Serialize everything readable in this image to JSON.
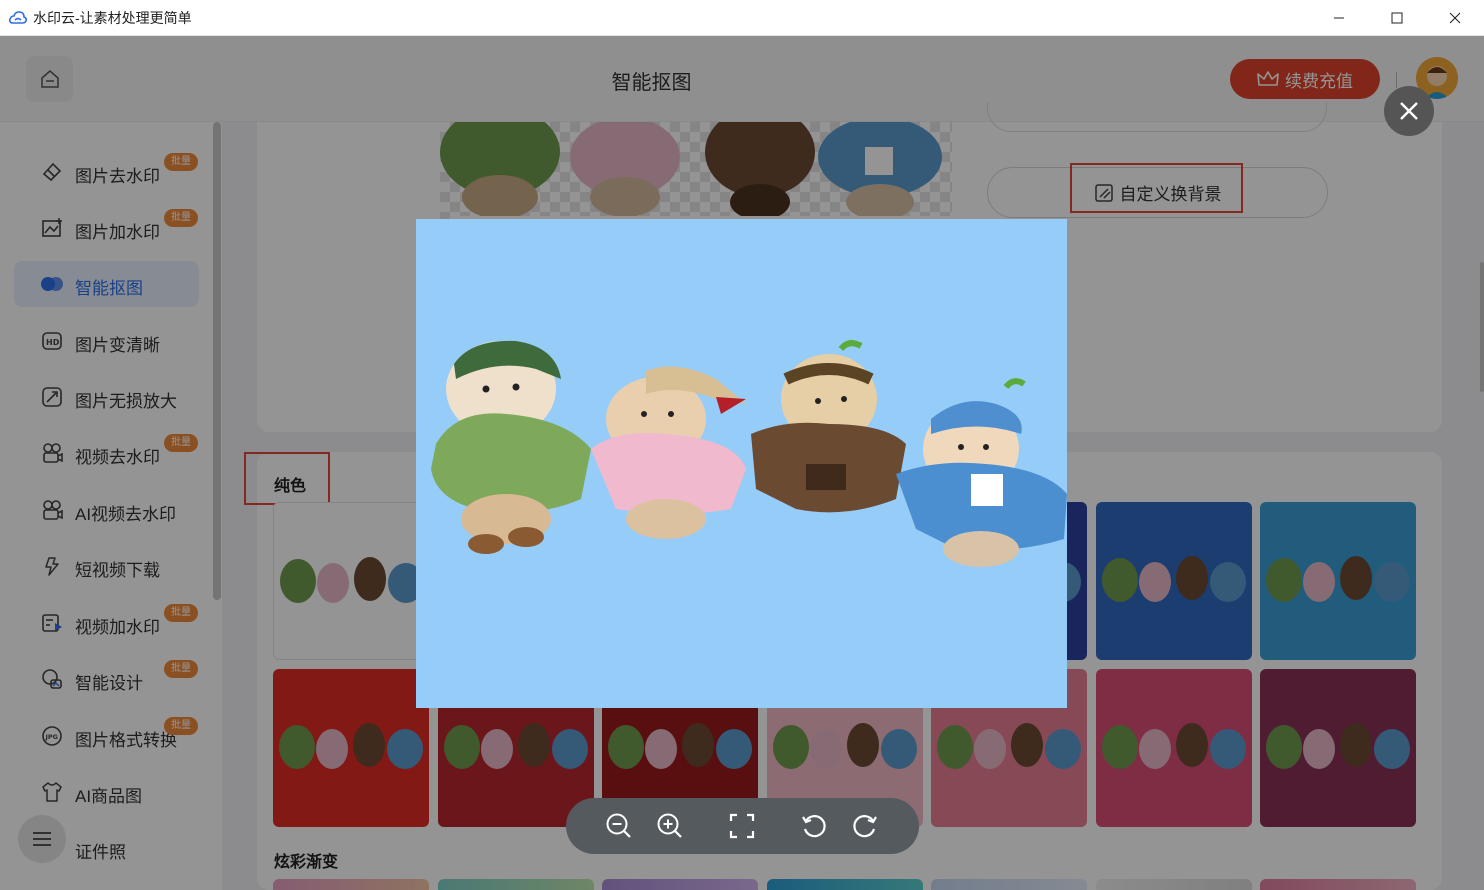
{
  "window": {
    "title": "水印云-让素材处理更简单"
  },
  "header": {
    "title": "智能抠图",
    "vip_label": "续费充值"
  },
  "sidebar": {
    "items": [
      {
        "label": "图片去水印",
        "badge": "批量"
      },
      {
        "label": "图片加水印",
        "badge": "批量"
      },
      {
        "label": "智能抠图",
        "badge": ""
      },
      {
        "label": "图片变清晰",
        "badge": ""
      },
      {
        "label": "图片无损放大",
        "badge": ""
      },
      {
        "label": "视频去水印",
        "badge": "批量"
      },
      {
        "label": "AI视频去水印",
        "badge": ""
      },
      {
        "label": "短视频下载",
        "badge": ""
      },
      {
        "label": "视频加水印",
        "badge": "批量"
      },
      {
        "label": "智能设计",
        "badge": "批量"
      },
      {
        "label": "图片格式转换",
        "badge": "批量"
      },
      {
        "label": "AI商品图",
        "badge": ""
      },
      {
        "label": "证件照",
        "badge": ""
      }
    ]
  },
  "main": {
    "custom_bg_label": "自定义换背景",
    "solid_section": "纯色",
    "gradient_section": "炫彩渐变",
    "solid_swatches_row1": [
      "#ffffff",
      "#2d3fa0",
      "#2f6ac0",
      "#3a9fd6"
    ],
    "solid_swatches_row2": [
      "#e12c25",
      "#b8262e",
      "#9a1a1a",
      "#f3b8c6",
      "#ea7f96",
      "#d94f78",
      "#8a3157"
    ],
    "gradient_colors": [
      "#e7a0c4",
      "#7fd1c9",
      "#a98ed8",
      "#2e9fd6",
      "#c6d8f3",
      "#f1f1f1",
      "#e07fa1"
    ]
  },
  "modal": {
    "background_color": "#96ccf8",
    "tools": [
      "zoom-out-icon",
      "zoom-in-icon",
      "fit-screen-icon",
      "rotate-left-icon",
      "rotate-right-icon"
    ]
  }
}
